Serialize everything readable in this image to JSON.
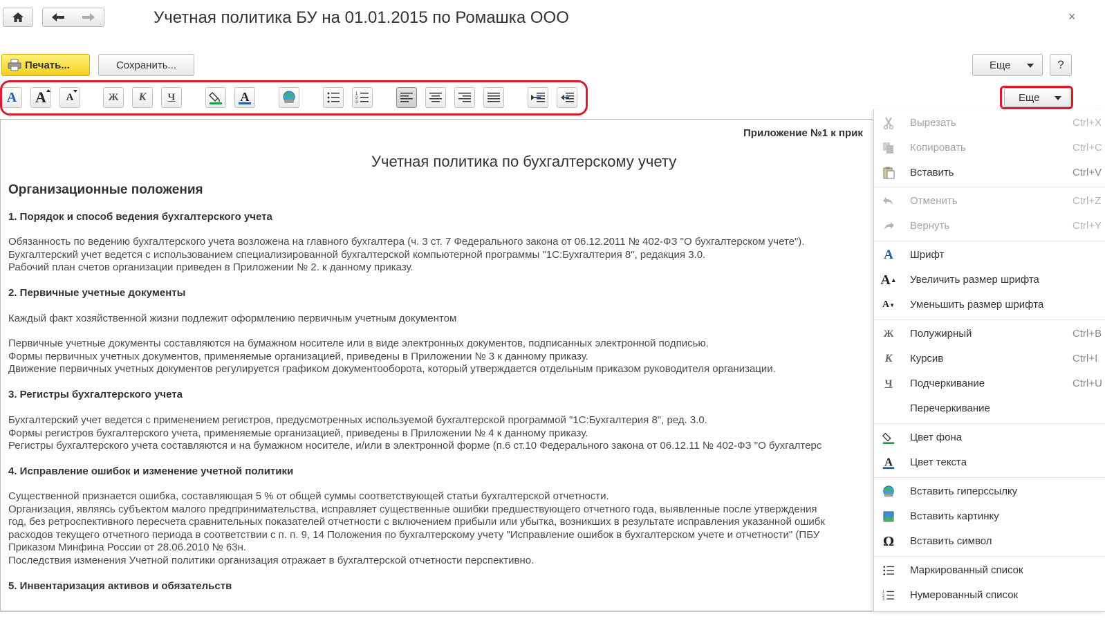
{
  "window": {
    "title": "Учетная политика БУ на 01.01.2015 по Ромашка ООО",
    "close": "×"
  },
  "toolbar": {
    "print_label": "Печать...",
    "save_label": "Сохранить...",
    "more_label": "Еще",
    "help_label": "?"
  },
  "format_toolbar": {
    "more_label": "Еще",
    "bold_glyph": "Ж",
    "italic_glyph": "К",
    "underline_glyph": "Ч",
    "font_glyph": "A"
  },
  "document": {
    "appendix": "Приложение №1 к прик",
    "title": "Учетная политика по бухгалтерскому учету",
    "section_title": "Организационные положения",
    "lines": [
      {
        "text": "1. Порядок и способ ведения бухгалтерского учета",
        "type": "h"
      },
      {
        "text": "Обязанность по ведению бухгалтерского учета возложена на главного бухгалтера (ч. 3 ст. 7 Федерального закона от 06.12.2011 № 402-ФЗ \"О бухгалтерском учете\").",
        "type": "p"
      },
      {
        "text": "Бухгалтерский учет ведется с использованием специализированной бухгалтерской компьютерной программы \"1С:Бухгалтерия 8\", редакция 3.0.",
        "type": "p"
      },
      {
        "text": "Рабочий план счетов организации приведен в Приложении № 2. к данному приказу.",
        "type": "p"
      },
      {
        "text": "2. Первичные учетные документы",
        "type": "h"
      },
      {
        "text": "Каждый факт хозяйственной жизни подлежит оформлению первичным учетным документом",
        "type": "p"
      },
      {
        "text": "Первичные учетные документы составляются на бумажном носителе или в виде электронных документов, подписанных электронной подписью.",
        "type": "p"
      },
      {
        "text": "Формы первичных учетных документов, применяемые организацией, приведены в Приложении № 3 к данному приказу.",
        "type": "p"
      },
      {
        "text": "Движение первичных учетных документов регулируется графиком документооборота, который утверждается отдельным приказом руководителя организации.",
        "type": "p"
      },
      {
        "text": "3. Регистры бухгалтерского учета",
        "type": "h"
      },
      {
        "text": "Бухгалтерский учет ведется с применением регистров, предусмотренных используемой бухгалтерской программой \"1С:Бухгалтерия 8\", ред. 3.0.",
        "type": "p"
      },
      {
        "text": "Формы регистров бухгалтерского учета, применяемые организацией, приведены в Приложении № 4 к данному приказу.",
        "type": "p"
      },
      {
        "text": "Регистры бухгалтерского учета составляются и на бумажном носителе, и/или в электронной форме (п.6 ст.10 Федерального закона от 06.12.11 № 402-ФЗ \"О бухгалтерс",
        "type": "p"
      },
      {
        "text": "4. Исправление ошибок и изменение учетной политики",
        "type": "h"
      },
      {
        "text": "Существенной признается ошибка, составляющая 5 % от общей суммы соответствующей статьи бухгалтерской отчетности.",
        "type": "p"
      },
      {
        "text": "Организация, являясь субъектом малого предпринимательства, исправляет существенные ошибки предшествующего отчетного года, выявленные после утверждения",
        "type": "p"
      },
      {
        "text": "год, без ретроспективного пересчета сравнительных показателей отчетности с включением прибыли или убытка, возникших в результате исправления указанной ошибк",
        "type": "p"
      },
      {
        "text": "расходов текущего отчетного периода в соответствии с п. п. 9, 14 Положения по бухгалтерскому учету \"Исправление ошибок в бухгалтерском учете и отчетности\" (ПБУ",
        "type": "p"
      },
      {
        "text": "Приказом Минфина России от 28.06.2010 № 63н.",
        "type": "p"
      },
      {
        "text": "Последствия изменения Учетной политики организация отражает в бухгалтерской отчетности перспективно.",
        "type": "p"
      },
      {
        "text": "5. Инвентаризация активов и обязательств",
        "type": "h"
      }
    ]
  },
  "context_menu": {
    "items": [
      {
        "label": "Вырезать",
        "shortcut": "Ctrl+X",
        "icon": "scissors-icon",
        "disabled": true
      },
      {
        "label": "Копировать",
        "shortcut": "Ctrl+C",
        "icon": "copy-icon",
        "disabled": true
      },
      {
        "label": "Вставить",
        "shortcut": "Ctrl+V",
        "icon": "paste-icon",
        "disabled": false
      },
      {
        "label": "Отменить",
        "shortcut": "Ctrl+Z",
        "icon": "undo-icon",
        "disabled": true
      },
      {
        "label": "Вернуть",
        "shortcut": "Ctrl+Y",
        "icon": "redo-icon",
        "disabled": true
      },
      {
        "label": "Шрифт",
        "shortcut": "",
        "icon": "font-icon",
        "disabled": false
      },
      {
        "label": "Увеличить размер шрифта",
        "shortcut": "",
        "icon": "font-increase-icon",
        "disabled": false
      },
      {
        "label": "Уменьшить размер шрифта",
        "shortcut": "",
        "icon": "font-decrease-icon",
        "disabled": false
      },
      {
        "label": "Полужирный",
        "shortcut": "Ctrl+B",
        "icon": "bold-icon",
        "disabled": false
      },
      {
        "label": "Курсив",
        "shortcut": "Ctrl+I",
        "icon": "italic-icon",
        "disabled": false
      },
      {
        "label": "Подчеркивание",
        "shortcut": "Ctrl+U",
        "icon": "underline-icon",
        "disabled": false
      },
      {
        "label": "Перечеркивание",
        "shortcut": "",
        "icon": "strikethrough-icon",
        "disabled": false
      },
      {
        "label": "Цвет фона",
        "shortcut": "",
        "icon": "background-color-icon",
        "disabled": false
      },
      {
        "label": "Цвет текста",
        "shortcut": "",
        "icon": "text-color-icon",
        "disabled": false
      },
      {
        "label": "Вставить гиперссылку",
        "shortcut": "",
        "icon": "hyperlink-icon",
        "disabled": false
      },
      {
        "label": "Вставить картинку",
        "shortcut": "",
        "icon": "image-icon",
        "disabled": false
      },
      {
        "label": "Вставить символ",
        "shortcut": "",
        "icon": "omega-icon",
        "disabled": false
      },
      {
        "label": "Маркированный список",
        "shortcut": "",
        "icon": "bulleted-list-icon",
        "disabled": false
      },
      {
        "label": "Нумерованный список",
        "shortcut": "",
        "icon": "numbered-list-icon",
        "disabled": false
      }
    ]
  },
  "colors": {
    "highlight": "#dd1a2a",
    "print_button": "#f3cf1d",
    "text": "#4a4a4a"
  }
}
